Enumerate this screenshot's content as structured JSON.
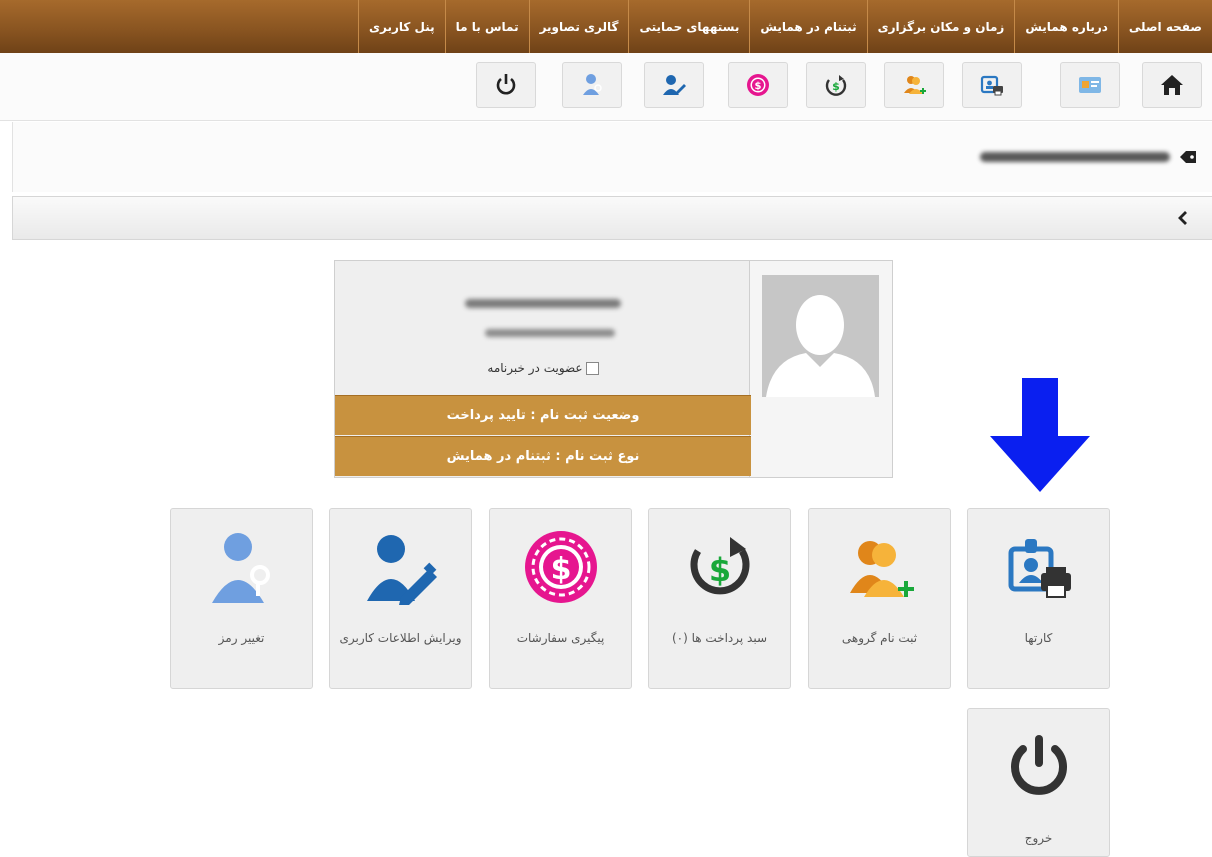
{
  "nav": {
    "items": [
      "صفحه اصلی",
      "درباره همایش",
      "زمان و مکان برگزاری",
      "ثبتنام در همایش",
      "بستههای حمایتی",
      "گالری تصاویر",
      "تماس با ما",
      "پنل کاربری"
    ]
  },
  "iconbar": {
    "buttons": [
      "home-icon",
      "profile-card-icon",
      "id-card-printer-icon",
      "group-register-icon",
      "payment-basket-icon",
      "orders-icon",
      "edit-user-icon",
      "change-password-icon",
      "logout-icon"
    ]
  },
  "profile": {
    "newsletter_label": "عضویت در خبرنامه",
    "newsletter_checked": false,
    "status_label": "وضعیت ثبت نام : تایید پرداخت",
    "type_label": "نوع ثبت نام : ثبتنام در همایش"
  },
  "tiles": {
    "cards": "کارتها",
    "group": "ثبت نام گروهی",
    "basket": "سبد پرداخت ها (۰)",
    "orders": "پیگیری سفارشات",
    "edit": "ویرایش اطلاعات کاربری",
    "password": "تغییر رمز",
    "logout": "خروج"
  },
  "colors": {
    "nav_brown": "#8a5521",
    "status_gold": "#c8923f",
    "arrow_blue": "#0a1ff0",
    "coin_pink": "#e6168f",
    "dollar_green": "#19a83a",
    "person_orange": "#f09a12",
    "person_blue": "#2b78c2"
  }
}
